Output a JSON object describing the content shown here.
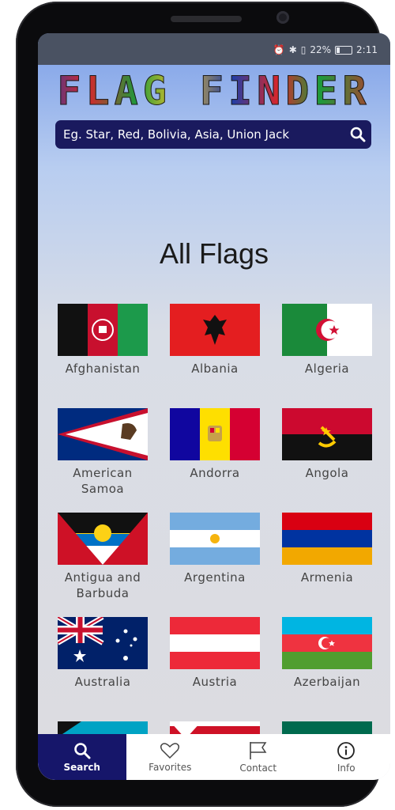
{
  "status": {
    "battery": "22%",
    "time": "2:11"
  },
  "app": {
    "title": "FLAG FINDER"
  },
  "search": {
    "placeholder": "Eg. Star, Red, Bolivia, Asia, Union Jack"
  },
  "section": {
    "heading": "All Flags"
  },
  "flags": [
    {
      "name": "Afghanistan"
    },
    {
      "name": "Albania"
    },
    {
      "name": "Algeria"
    },
    {
      "name": "American Samoa"
    },
    {
      "name": "Andorra"
    },
    {
      "name": "Angola"
    },
    {
      "name": "Antigua and Barbuda"
    },
    {
      "name": "Argentina"
    },
    {
      "name": "Armenia"
    },
    {
      "name": "Australia"
    },
    {
      "name": "Austria"
    },
    {
      "name": "Azerbaijan"
    }
  ],
  "tabs": [
    {
      "label": "Search",
      "icon": "search-icon",
      "active": true
    },
    {
      "label": "Favorites",
      "icon": "heart-icon",
      "active": false
    },
    {
      "label": "Contact",
      "icon": "flag-icon",
      "active": false
    },
    {
      "label": "Info",
      "icon": "info-icon",
      "active": false
    }
  ]
}
